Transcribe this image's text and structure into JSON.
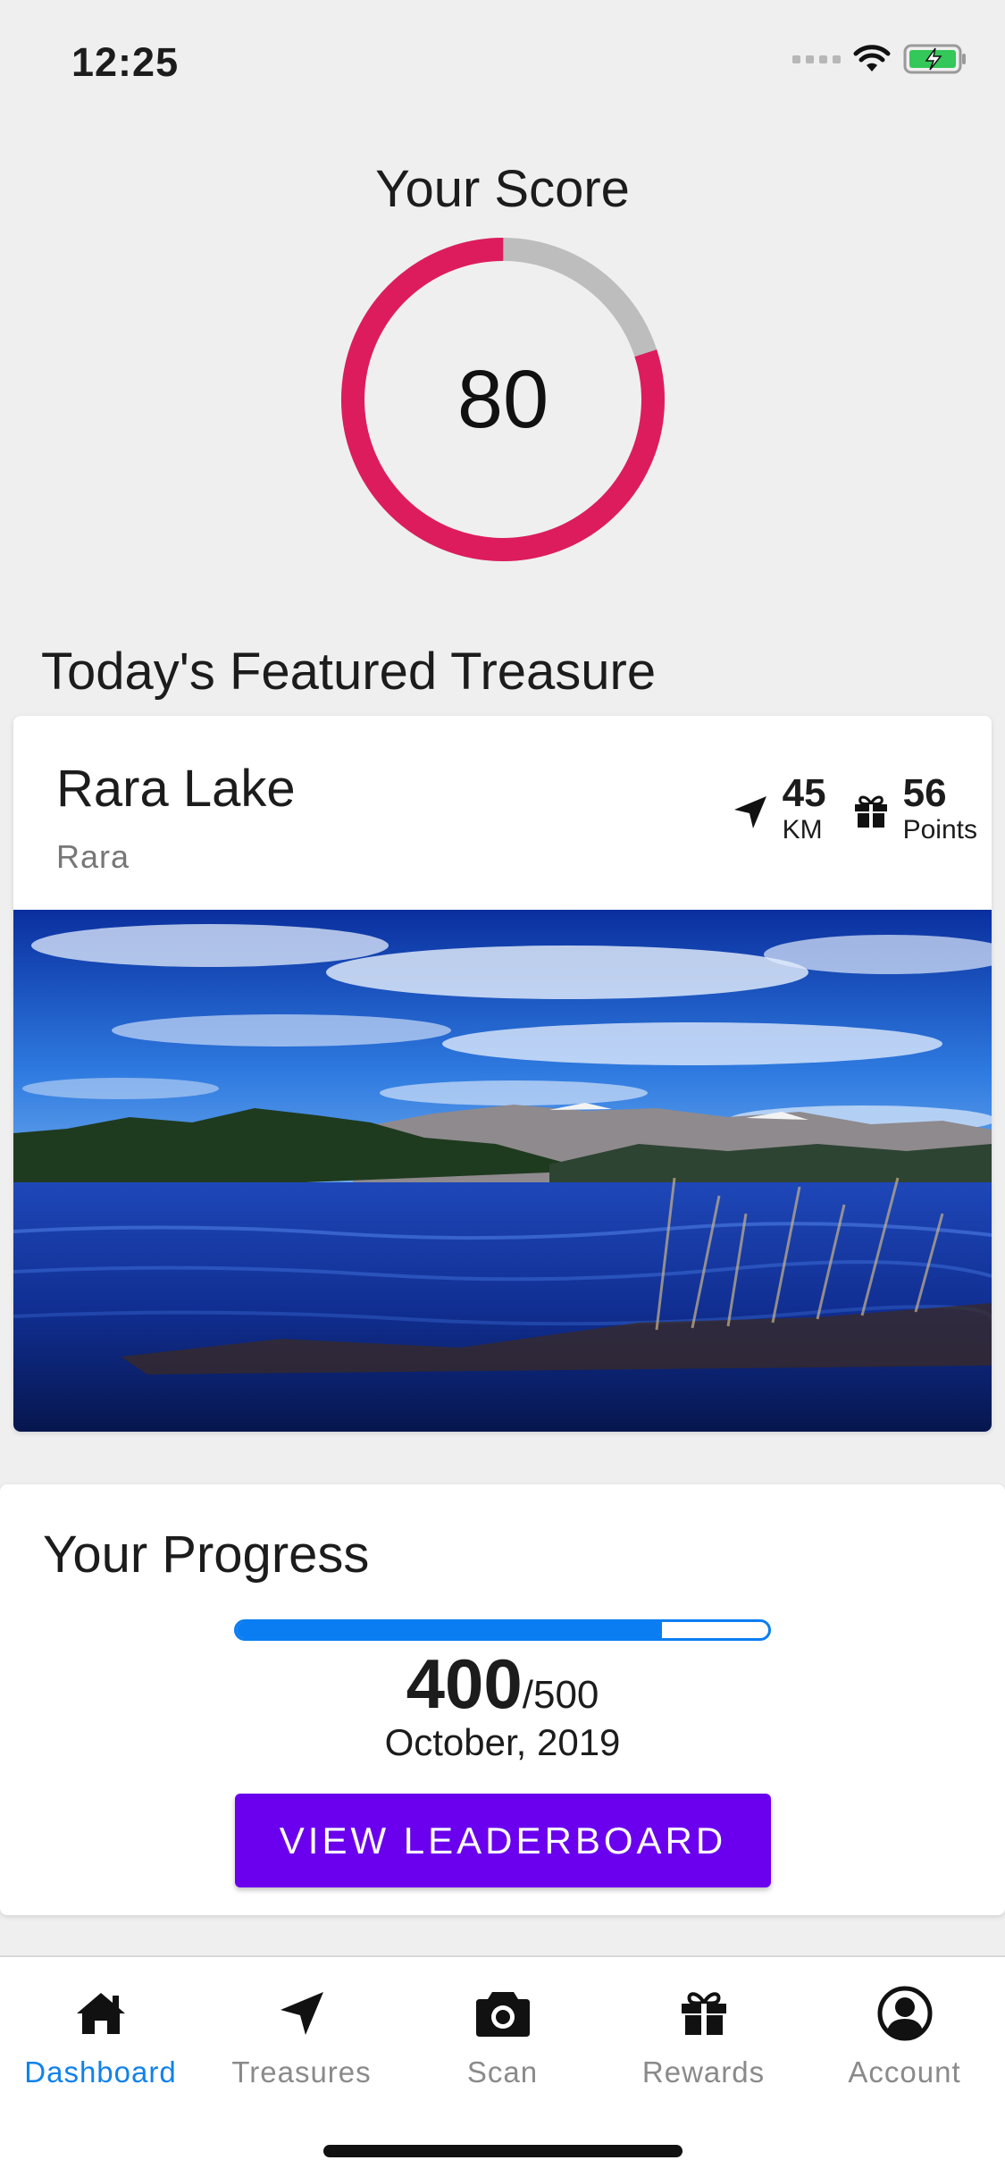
{
  "status_bar": {
    "time": "12:25"
  },
  "score": {
    "title": "Your Score",
    "value": "80",
    "fraction": 0.8,
    "ring_color": "#dd1c5e",
    "track_color": "#bdbdbd"
  },
  "featured": {
    "section_title": "Today's Featured Treasure",
    "name": "Rara Lake",
    "region": "Rara",
    "distance_value": "45",
    "distance_unit": "KM",
    "points_value": "56",
    "points_unit": "Points"
  },
  "progress": {
    "title": "Your Progress",
    "current": "400",
    "total": "/500",
    "fraction": 0.8,
    "period": "October, 2019",
    "button_label": "VIEW LEADERBOARD",
    "bar_color": "#0a7df2",
    "button_color": "#6a00ee"
  },
  "tabs": [
    {
      "label": "Dashboard",
      "icon": "home-icon",
      "active": true
    },
    {
      "label": "Treasures",
      "icon": "navigation-arrow-icon",
      "active": false
    },
    {
      "label": "Scan",
      "icon": "camera-icon",
      "active": false
    },
    {
      "label": "Rewards",
      "icon": "gift-icon",
      "active": false
    },
    {
      "label": "Account",
      "icon": "account-circle-icon",
      "active": false
    }
  ]
}
